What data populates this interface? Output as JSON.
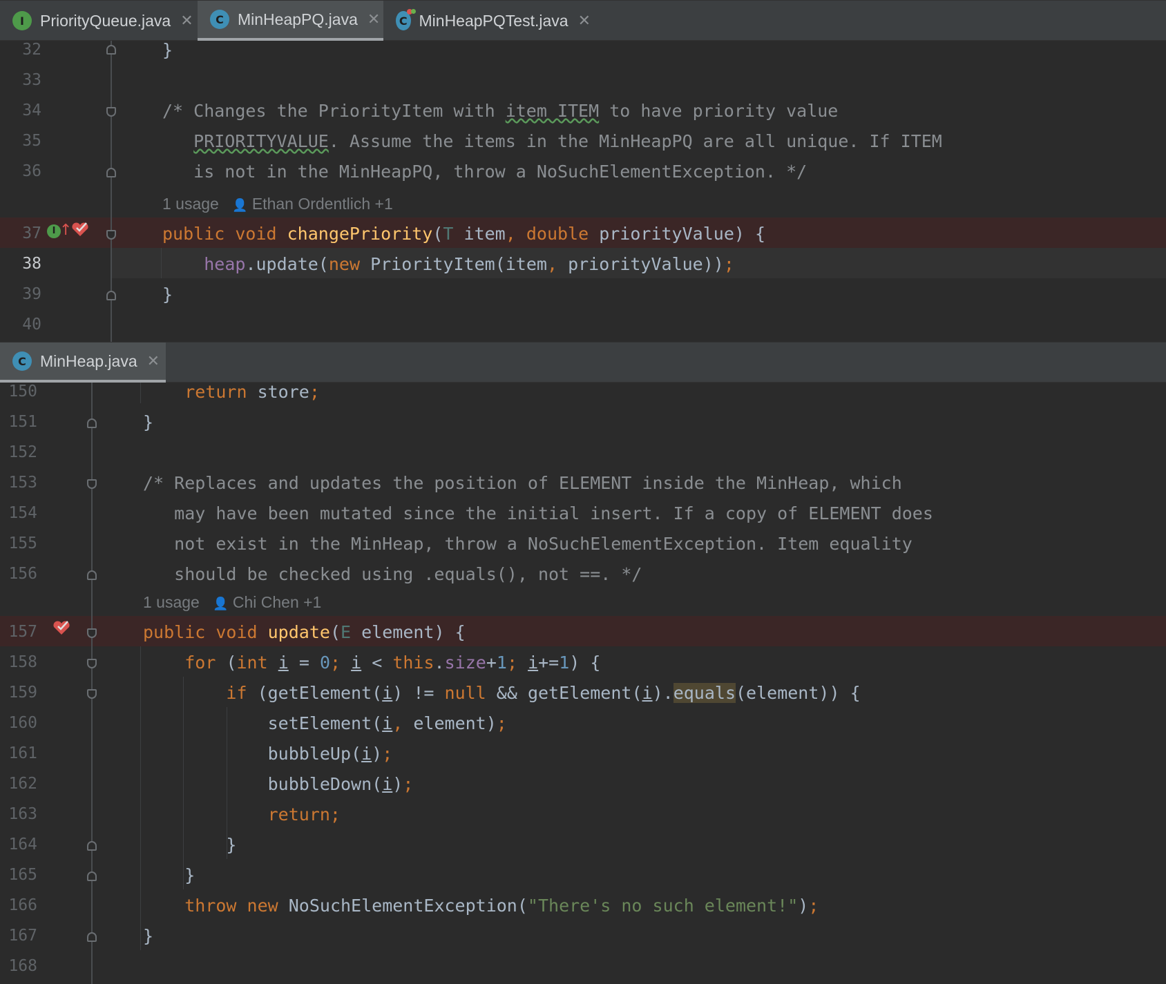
{
  "top": {
    "tabs": [
      {
        "label": "PriorityQueue.java",
        "icon": "I"
      },
      {
        "label": "MinHeapPQ.java",
        "icon": "C"
      },
      {
        "label": "MinHeapPQTest.java",
        "icon": "C"
      }
    ],
    "close_glyph": "✕",
    "lines": [
      "32",
      "33",
      "34",
      "35",
      "36",
      "37",
      "38",
      "39",
      "40"
    ],
    "hint": {
      "usages": "1 usage",
      "author": "Ethan Ordentlich +1"
    }
  },
  "bottom": {
    "tab": {
      "label": "MinHeap.java",
      "icon": "C"
    },
    "lines": [
      "150",
      "151",
      "152",
      "153",
      "154",
      "155",
      "156",
      "157",
      "158",
      "159",
      "160",
      "161",
      "162",
      "163",
      "164",
      "165",
      "166",
      "167",
      "168"
    ],
    "hint": {
      "usages": "1 usage",
      "author": "Chi Chen +1"
    }
  }
}
